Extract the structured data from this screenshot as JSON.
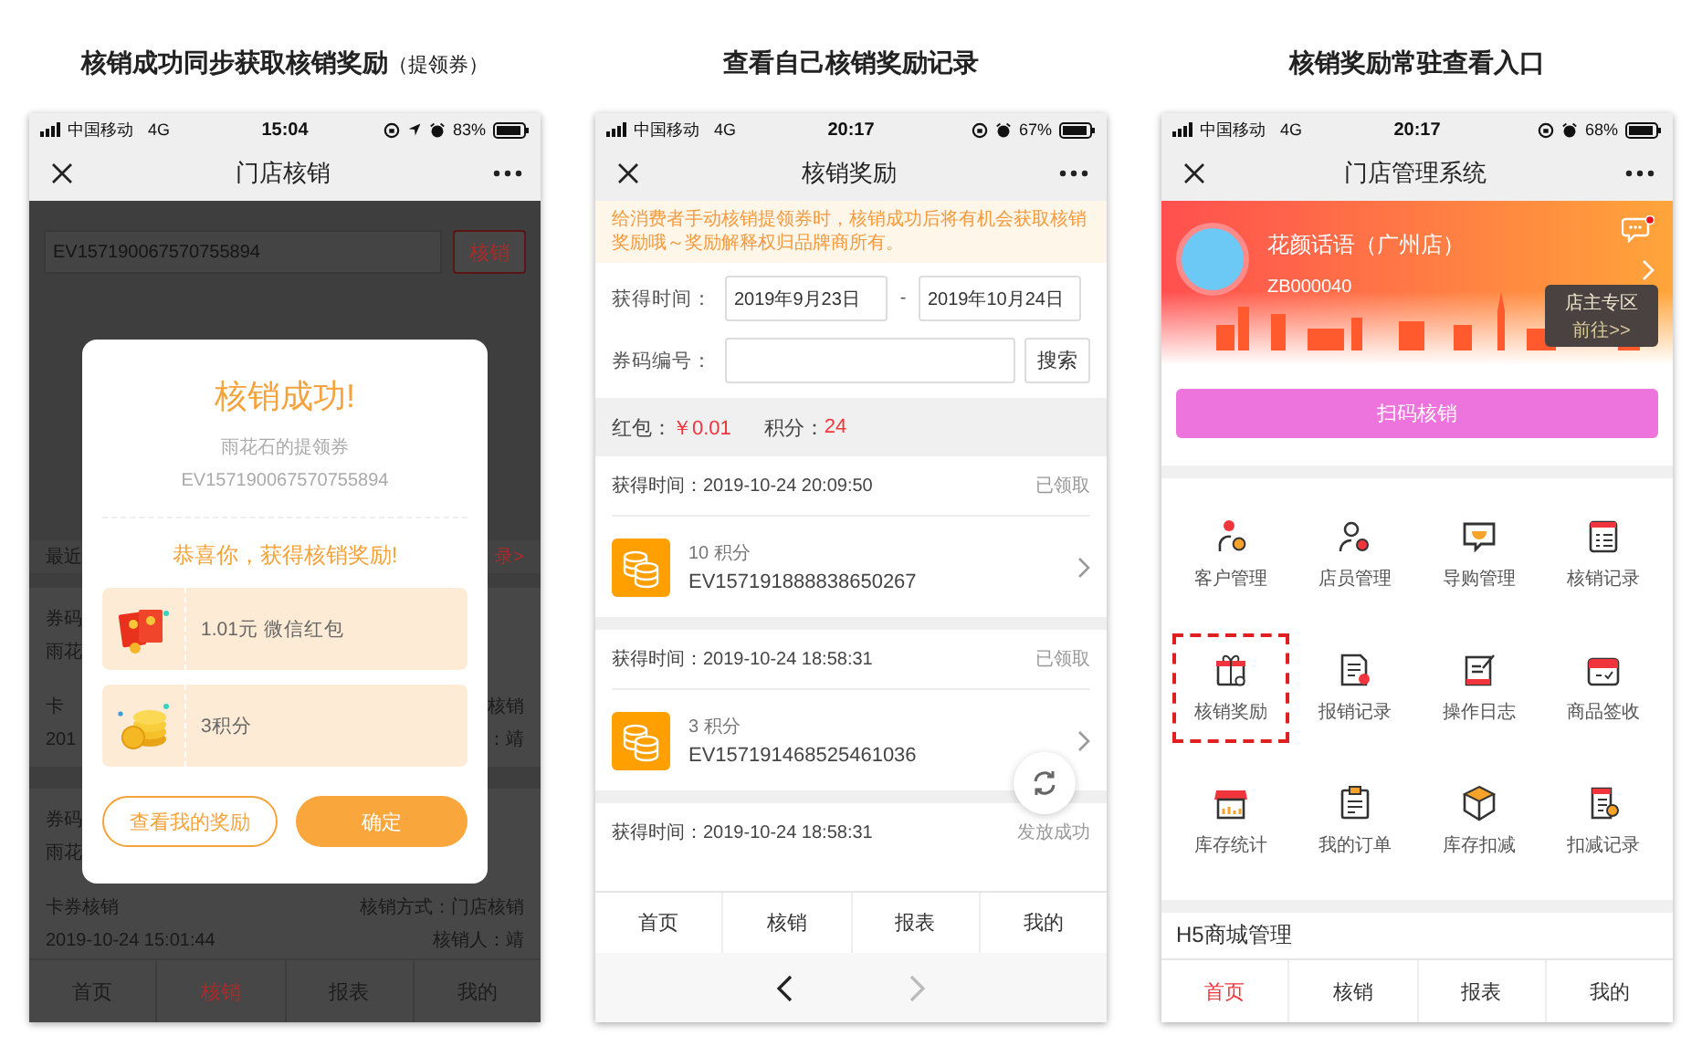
{
  "screens": [
    {
      "kind": "verify_dialog",
      "caption": "核销成功同步获取核销奖励",
      "caption_note": "（提领券）",
      "status_bar": {
        "carrier": "中国移动",
        "network": "4G",
        "time": "15:04",
        "battery": "83%",
        "location": true
      },
      "title": "门店核销",
      "code_field": {
        "value": "EV157190067570755894"
      },
      "verify_button": "核销",
      "recent": {
        "label": "最近",
        "link": "录>"
      },
      "records": [
        {
          "code_label": "券码",
          "name": "雨花",
          "type": "卡",
          "method": "核销",
          "time": "201",
          "operator": "：靖"
        },
        {
          "code_label": "券码",
          "name": "雨花",
          "type": "卡券核销",
          "method": "核销方式：门店核销",
          "time": "2019-10-24 15:01:44",
          "operator": "核销人：靖"
        }
      ],
      "dialog": {
        "title": "核销成功!",
        "coupon_name": "雨花石的提领券",
        "coupon_code": "EV157190067570755894",
        "message": "恭喜你，获得核销奖励!",
        "rewards": [
          {
            "kind": "red_packet",
            "text": "1.01元 微信红包"
          },
          {
            "kind": "points",
            "text": "3积分"
          }
        ],
        "buttons": [
          {
            "kind": "secondary",
            "label": "查看我的奖励"
          },
          {
            "kind": "primary",
            "label": "确定"
          }
        ]
      },
      "tabs": [
        {
          "label": "首页",
          "selected": false
        },
        {
          "label": "核销",
          "selected": true
        },
        {
          "label": "报表",
          "selected": false
        },
        {
          "label": "我的",
          "selected": false
        }
      ]
    },
    {
      "kind": "reward_records",
      "caption": "查看自己核销奖励记录",
      "status_bar": {
        "carrier": "中国移动",
        "network": "4G",
        "time": "20:17",
        "battery": "67%",
        "location": false
      },
      "title": "核销奖励",
      "notice": "给消费者手动核销提领券时，核销成功后将有机会获取核销奖励哦～奖励解释权归品牌商所有。",
      "filters": {
        "date_label": "获得时间：",
        "date_from": "2019年9月23日",
        "separator": "-",
        "date_to": "2019年10月24日",
        "code_label": "券码编号：",
        "search_button": "搜索"
      },
      "summary": {
        "red_packet_label": "红包：",
        "red_packet": "￥0.01",
        "points_label": "积分：",
        "points": "24"
      },
      "records": [
        {
          "time": "获得时间：2019-10-24 20:09:50",
          "status": "已领取",
          "reward": {
            "points": "10 积分",
            "code": "EV157191888838650267"
          }
        },
        {
          "time": "获得时间：2019-10-24 18:58:31",
          "status": "已领取",
          "reward": {
            "points": "3 积分",
            "code": "EV157191468525461036"
          }
        },
        {
          "time": "获得时间：2019-10-24 18:58:31",
          "status": "发放成功"
        }
      ],
      "tabs": [
        {
          "label": "首页",
          "selected": false
        },
        {
          "label": "核销",
          "selected": false
        },
        {
          "label": "报表",
          "selected": false
        },
        {
          "label": "我的",
          "selected": false
        }
      ],
      "browser_nav": {
        "back_disabled": false,
        "forward_disabled": true
      }
    },
    {
      "kind": "store_home",
      "caption": "核销奖励常驻查看入口",
      "status_bar": {
        "carrier": "中国移动",
        "network": "4G",
        "time": "20:17",
        "battery": "68%",
        "location": false
      },
      "title": "门店管理系统",
      "store": {
        "name": "花颜话语（广州店）",
        "code": "ZB000040",
        "unread": true,
        "owner_zone": {
          "label": "店主专区",
          "link": "前往>>"
        }
      },
      "scan_button": "扫码核销",
      "features": [
        {
          "label": "客户管理",
          "highlighted": false
        },
        {
          "label": "店员管理",
          "highlighted": false
        },
        {
          "label": "导购管理",
          "highlighted": false
        },
        {
          "label": "核销记录",
          "highlighted": false
        },
        {
          "label": "核销奖励",
          "highlighted": true
        },
        {
          "label": "报销记录",
          "highlighted": false
        },
        {
          "label": "操作日志",
          "highlighted": false
        },
        {
          "label": "商品签收",
          "highlighted": false
        },
        {
          "label": "库存统计",
          "highlighted": false
        },
        {
          "label": "我的订单",
          "highlighted": false
        },
        {
          "label": "库存扣减",
          "highlighted": false
        },
        {
          "label": "扣减记录",
          "highlighted": false
        }
      ],
      "section_title": "H5商城管理",
      "tabs": [
        {
          "label": "首页",
          "selected": true
        },
        {
          "label": "核销",
          "selected": false
        },
        {
          "label": "报表",
          "selected": false
        },
        {
          "label": "我的",
          "selected": false
        }
      ]
    }
  ]
}
